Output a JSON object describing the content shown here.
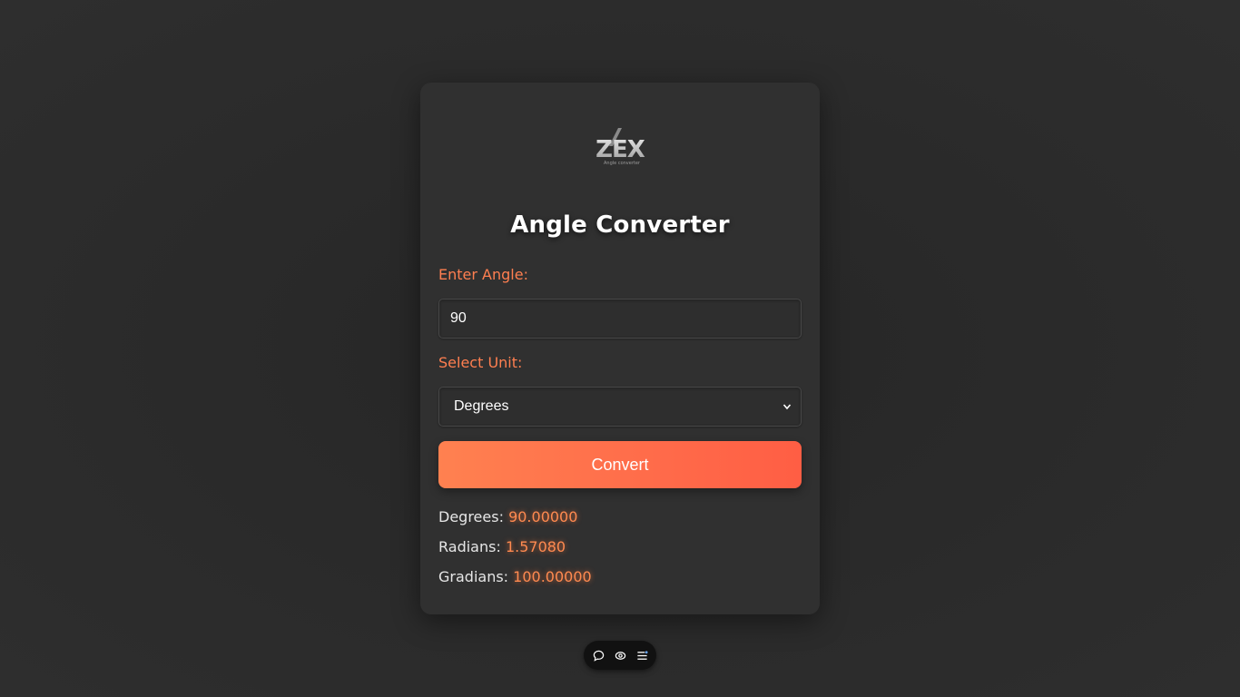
{
  "logo": {
    "text": "ZEX",
    "tagline": "Angle converter"
  },
  "title": "Angle Converter",
  "form": {
    "angle_label": "Enter Angle:",
    "angle_value": "90",
    "unit_label": "Select Unit:",
    "unit_selected": "Degrees",
    "convert_label": "Convert"
  },
  "results": {
    "degrees_label": "Degrees:",
    "degrees_value": "90.00000",
    "radians_label": "Radians:",
    "radians_value": "1.57080",
    "gradians_label": "Gradians:",
    "gradians_value": "100.00000"
  },
  "toolbar": {
    "icons": [
      "chat-icon",
      "eye-icon",
      "menu-icon"
    ]
  },
  "colors": {
    "accent": "#ff7f50",
    "card_bg": "#303030",
    "page_bg": "#2b2b2b"
  }
}
